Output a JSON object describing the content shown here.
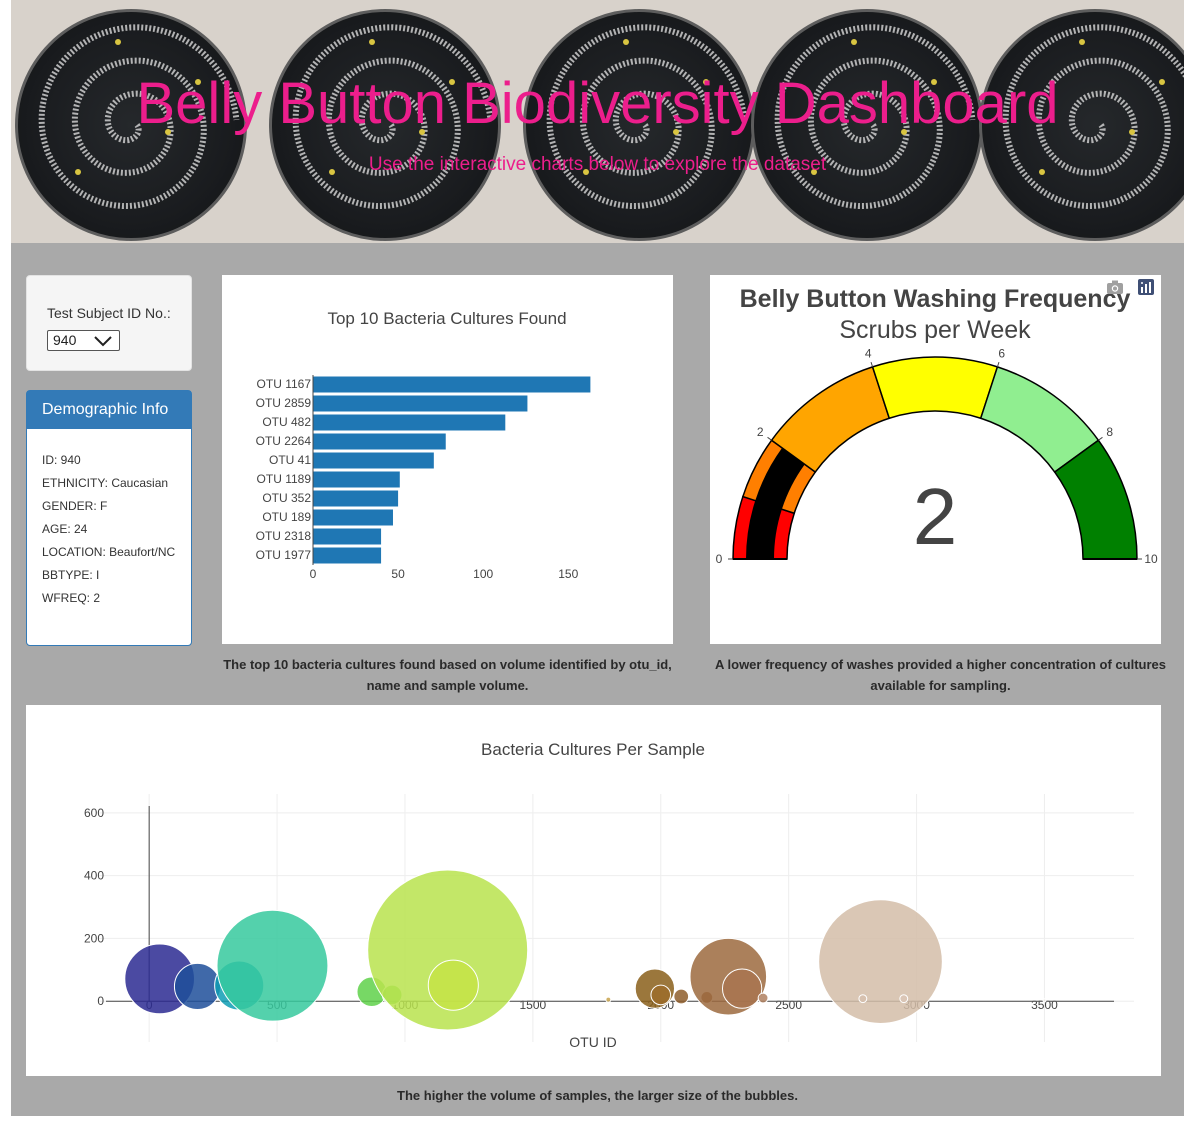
{
  "header": {
    "title": "Belly Button Biodiversity Dashboard",
    "subtitle": "Use the interactive charts below to explore the dataset"
  },
  "selector": {
    "label": "Test Subject ID No.:",
    "value": "940"
  },
  "demographics": {
    "heading": "Demographic Info",
    "items": [
      "ID: 940",
      "ETHNICITY: Caucasian",
      "GENDER: F",
      "AGE: 24",
      "LOCATION: Beaufort/NC",
      "BBTYPE: I",
      "WFREQ: 2"
    ]
  },
  "bar_caption": "The top 10 bacteria cultures found based on volume identified by otu_id, name and sample volume.",
  "gauge_caption": "A lower frequency of washes provided a higher concentration of cultures available for sampling.",
  "bubble_caption": "The higher the volume of samples, the larger size of the bubbles.",
  "chart_data": [
    {
      "type": "bar",
      "orientation": "horizontal",
      "title": "Top 10 Bacteria Cultures Found",
      "categories": [
        "OTU 1167",
        "OTU 2859",
        "OTU 482",
        "OTU 2264",
        "OTU 41",
        "OTU 1189",
        "OTU 352",
        "OTU 189",
        "OTU 2318",
        "OTU 1977"
      ],
      "values": [
        163,
        126,
        113,
        78,
        71,
        51,
        50,
        47,
        40,
        40
      ],
      "xticks": [
        0,
        50,
        100,
        150
      ],
      "xlim": [
        0,
        171
      ],
      "color": "#1f77b4"
    },
    {
      "type": "gauge",
      "title": "Belly Button Washing Frequency",
      "subtitle": "Scrubs per Week",
      "value": 2,
      "range": [
        0,
        10
      ],
      "ticks": [
        0,
        2,
        4,
        6,
        8,
        10
      ],
      "bands": [
        {
          "from": 0,
          "to": 1,
          "color": "#ff0000"
        },
        {
          "from": 1,
          "to": 2,
          "color": "#ff7f00"
        },
        {
          "from": 2,
          "to": 4,
          "color": "#ffa500"
        },
        {
          "from": 4,
          "to": 6,
          "color": "#ffff00"
        },
        {
          "from": 6,
          "to": 8,
          "color": "#90ee90"
        },
        {
          "from": 8,
          "to": 10,
          "color": "#008000"
        }
      ],
      "value_bar_color": "#000000"
    },
    {
      "type": "scatter",
      "variant": "bubble",
      "title": "Bacteria Cultures Per Sample",
      "xlabel": "OTU ID",
      "ylabel": "",
      "xlim": [
        -200,
        3850
      ],
      "ylim": [
        -130,
        660
      ],
      "xticks": [
        0,
        500,
        1000,
        1500,
        2000,
        2500,
        3000,
        3500
      ],
      "yticks": [
        0,
        200,
        400,
        600
      ],
      "grid": true,
      "points": [
        {
          "x": 41,
          "y": 71,
          "size": 71,
          "color": "#2c2a92"
        },
        {
          "x": 189,
          "y": 47,
          "size": 47,
          "color": "#1e4f9a"
        },
        {
          "x": 352,
          "y": 50,
          "size": 50,
          "color": "#0f9db4"
        },
        {
          "x": 482,
          "y": 113,
          "size": 113,
          "color": "#36c99e"
        },
        {
          "x": 870,
          "y": 30,
          "size": 30,
          "color": "#5fd14a"
        },
        {
          "x": 950,
          "y": 20,
          "size": 20,
          "color": "#6fd74c"
        },
        {
          "x": 1167,
          "y": 163,
          "size": 163,
          "color": "#b8e34e"
        },
        {
          "x": 1189,
          "y": 51,
          "size": 51,
          "color": "#c6e346"
        },
        {
          "x": 1795,
          "y": 5,
          "size": 5,
          "color": "#c8a34c"
        },
        {
          "x": 1977,
          "y": 40,
          "size": 40,
          "color": "#8a5f1a"
        },
        {
          "x": 2000,
          "y": 20,
          "size": 20,
          "color": "#9c6c2a"
        },
        {
          "x": 2080,
          "y": 15,
          "size": 15,
          "color": "#8e5e2c"
        },
        {
          "x": 2180,
          "y": 12,
          "size": 12,
          "color": "#8f5b35"
        },
        {
          "x": 2264,
          "y": 78,
          "size": 78,
          "color": "#9c6a3e"
        },
        {
          "x": 2318,
          "y": 40,
          "size": 40,
          "color": "#a87450"
        },
        {
          "x": 2400,
          "y": 10,
          "size": 10,
          "color": "#b08060"
        },
        {
          "x": 2859,
          "y": 126,
          "size": 126,
          "color": "#d4bda8"
        },
        {
          "x": 2790,
          "y": 8,
          "size": 8,
          "color": "#d6c0ae"
        },
        {
          "x": 2950,
          "y": 8,
          "size": 8,
          "color": "#dac6b6"
        },
        {
          "x": 3500,
          "y": 3,
          "size": 3,
          "color": "#f0ece8"
        }
      ]
    }
  ]
}
